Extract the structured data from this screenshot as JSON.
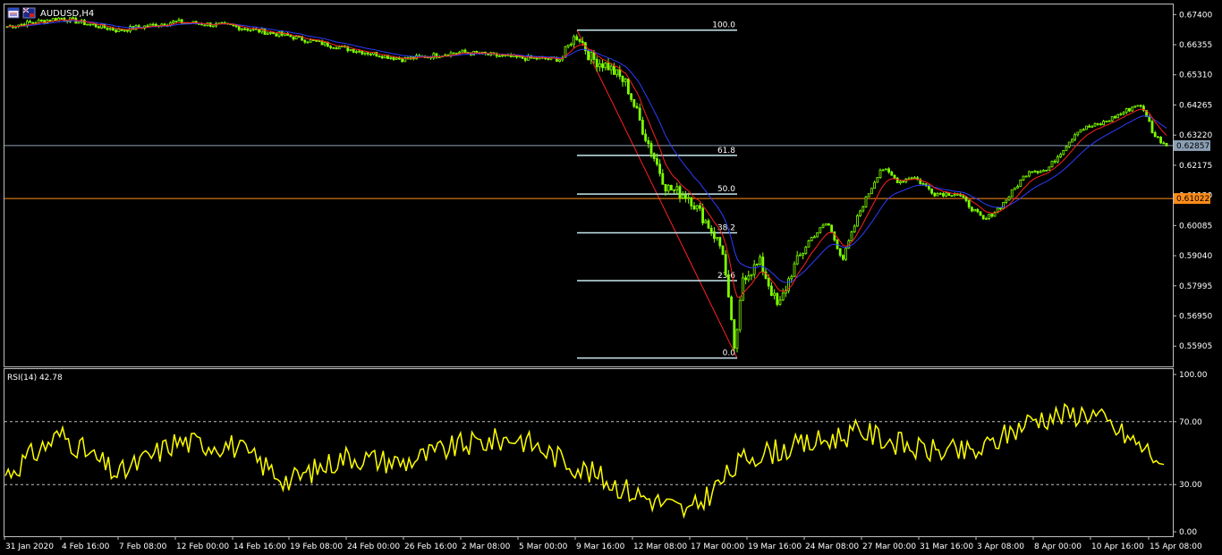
{
  "window": {
    "title": "AUDUSD,H4"
  },
  "colors": {
    "background": "#000000",
    "candle": "#7fff00",
    "ma_fast": "#ff2020",
    "ma_slow": "#2d3cff",
    "rsi": "#ffff00",
    "fib": "#c8e8f0",
    "fib_diag": "#ff2020",
    "bid_line": "#8ca0b4",
    "level_line": "#ff8c1a",
    "frame": "#c0c0c0"
  },
  "price_scale": {
    "ticks": [
      "0.67400",
      "0.66355",
      "0.65310",
      "0.64265",
      "0.63220",
      "0.62175",
      "0.61130",
      "0.60085",
      "0.59040",
      "0.57995",
      "0.56950",
      "0.55905"
    ],
    "current_price": "0.62857",
    "level_price": "0.61022"
  },
  "time_axis": {
    "ticks": [
      "31 Jan 2020",
      "4 Feb 16:00",
      "7 Feb 08:00",
      "12 Feb 00:00",
      "14 Feb 16:00",
      "19 Feb 08:00",
      "24 Feb 00:00",
      "26 Feb 16:00",
      "2 Mar 08:00",
      "5 Mar 00:00",
      "9 Mar 16:00",
      "12 Mar 08:00",
      "17 Mar 00:00",
      "19 Mar 16:00",
      "24 Mar 08:00",
      "27 Mar 00:00",
      "31 Mar 16:00",
      "3 Apr 08:00",
      "8 Apr 00:00",
      "10 Apr 16:00",
      "15 Apr 08:00"
    ]
  },
  "fibonacci": {
    "levels": [
      "100.0",
      "61.8",
      "50.0",
      "38.2",
      "23.6",
      "0.0"
    ],
    "high": 0.6686,
    "low": 0.5549
  },
  "rsi_panel": {
    "label": "RSI(14) 42.78",
    "ticks": [
      "100.00",
      "70.00",
      "30.00",
      "0.00"
    ],
    "levels": [
      70,
      30
    ],
    "range": [
      0,
      100
    ]
  },
  "chart_data": {
    "type": "line",
    "symbol": "AUDUSD",
    "timeframe": "H4",
    "x": [
      "31 Jan 2020",
      "4 Feb 16:00",
      "7 Feb 08:00",
      "12 Feb 00:00",
      "14 Feb 16:00",
      "19 Feb 08:00",
      "24 Feb 00:00",
      "26 Feb 16:00",
      "2 Mar 08:00",
      "5 Mar 00:00",
      "9 Mar 16:00",
      "12 Mar 08:00",
      "17 Mar 00:00",
      "19 Mar 16:00",
      "24 Mar 08:00",
      "27 Mar 00:00",
      "31 Mar 16:00",
      "3 Apr 08:00",
      "8 Apr 00:00",
      "10 Apr 16:00",
      "15 Apr 08:00"
    ],
    "price_ylim": [
      0.552,
      0.6775
    ],
    "series": [
      {
        "values": [
          0.6697,
          0.6728,
          0.6685,
          0.6715,
          0.67,
          0.6665,
          0.6622,
          0.6585,
          0.661,
          0.659,
          0.6545,
          0.6395,
          0.606,
          0.575,
          0.595,
          0.615,
          0.608,
          0.6025,
          0.621,
          0.64,
          0.6286
        ]
      }
    ],
    "rsi_values": [
      36,
      62,
      36,
      57,
      55,
      32,
      48,
      44,
      55,
      60,
      42,
      25,
      12,
      48,
      55,
      64,
      52,
      50,
      72,
      76,
      42.78
    ],
    "rsi_ylim": [
      0,
      100
    ]
  }
}
